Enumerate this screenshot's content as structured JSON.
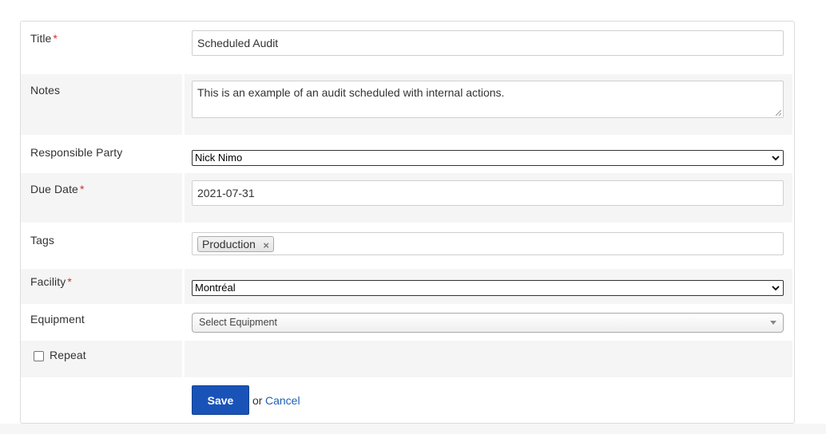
{
  "form": {
    "title": {
      "label": "Title",
      "required_mark": "*",
      "value": "Scheduled Audit"
    },
    "notes": {
      "label": "Notes",
      "value": "This is an example of an audit scheduled with internal actions."
    },
    "responsible_party": {
      "label": "Responsible Party",
      "selected": "Nick Nimo"
    },
    "due_date": {
      "label": "Due Date",
      "required_mark": "*",
      "value": "2021-07-31"
    },
    "tags": {
      "label": "Tags",
      "chips": [
        "Production"
      ],
      "remove_glyph": "×"
    },
    "facility": {
      "label": "Facility",
      "required_mark": "*",
      "selected": "Montréal"
    },
    "equipment": {
      "label": "Equipment",
      "placeholder": "Select Equipment"
    },
    "repeat": {
      "label": "Repeat",
      "checked": false
    }
  },
  "actions": {
    "save_label": "Save",
    "or_text": "or",
    "cancel_label": "Cancel"
  },
  "colors": {
    "required": "#d62c2c",
    "primary_button": "#1a53b8",
    "link": "#1f5fb0",
    "shaded_row": "#f5f5f5"
  }
}
